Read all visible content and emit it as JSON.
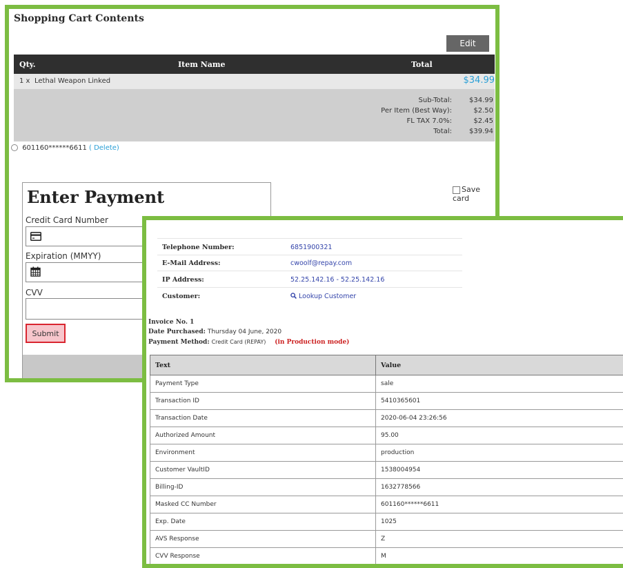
{
  "cart": {
    "title": "Shopping Cart Contents",
    "edit_label": "Edit",
    "headers": {
      "qty": "Qty.",
      "item": "Item Name",
      "total": "Total"
    },
    "item": {
      "qty": "1 x",
      "name": "Lethal Weapon Linked",
      "price": "$34.99"
    },
    "totals": [
      {
        "label": "Sub-Total:",
        "value": "$34.99"
      },
      {
        "label": "Per Item (Best Way):",
        "value": "$2.50"
      },
      {
        "label": "FL TAX 7.0%:",
        "value": "$2.45"
      },
      {
        "label": "Total:",
        "value": "$39.94"
      }
    ],
    "saved_card": "601160******6611",
    "delete_label": "( Delete)",
    "save_card_label": "Save card"
  },
  "payment": {
    "title": "Enter Payment",
    "card_label": "Credit Card Number",
    "exp_label": "Expiration (MMYY)",
    "cvv_label": "CVV",
    "submit_label": "Submit",
    "icons": {
      "card": "credit-card-icon",
      "exp": "calendar-icon"
    }
  },
  "details": {
    "info": [
      {
        "label": "Telephone Number:",
        "value": "6851900321"
      },
      {
        "label": "E-Mail Address:",
        "value": "cwoolf@repay.com"
      },
      {
        "label": "IP Address:",
        "value": "52.25.142.16 - 52.25.142.16"
      },
      {
        "label": "Customer:",
        "value": "Lookup Customer"
      }
    ],
    "invoice_no": "Invoice No. 1",
    "date_label": "Date Purchased:",
    "date_value": "Thursday 04 June, 2020",
    "method_label": "Payment Method:",
    "method_value": "Credit Card (REPAY)",
    "mode_value": "(in Production mode)",
    "table_headers": {
      "text": "Text",
      "value": "Value"
    },
    "rows": [
      {
        "text": "Payment Type",
        "value": "sale"
      },
      {
        "text": "Transaction ID",
        "value": "5410365601"
      },
      {
        "text": "Transaction Date",
        "value": "2020-06-04 23:26:56"
      },
      {
        "text": "Authorized Amount",
        "value": "95.00"
      },
      {
        "text": "Environment",
        "value": "production"
      },
      {
        "text": "Customer VaultID",
        "value": "1538004954"
      },
      {
        "text": "Billing-ID",
        "value": "1632778566"
      },
      {
        "text": "Masked CC Number",
        "value": "601160******6611"
      },
      {
        "text": "Exp. Date",
        "value": "1025"
      },
      {
        "text": "AVS Response",
        "value": "Z"
      },
      {
        "text": "CVV Response",
        "value": "M"
      }
    ]
  },
  "colors": {
    "frame": "#7cbd42",
    "link": "#2a9fd6",
    "header": "#2f2f2f",
    "submit_border": "#d9252f"
  }
}
